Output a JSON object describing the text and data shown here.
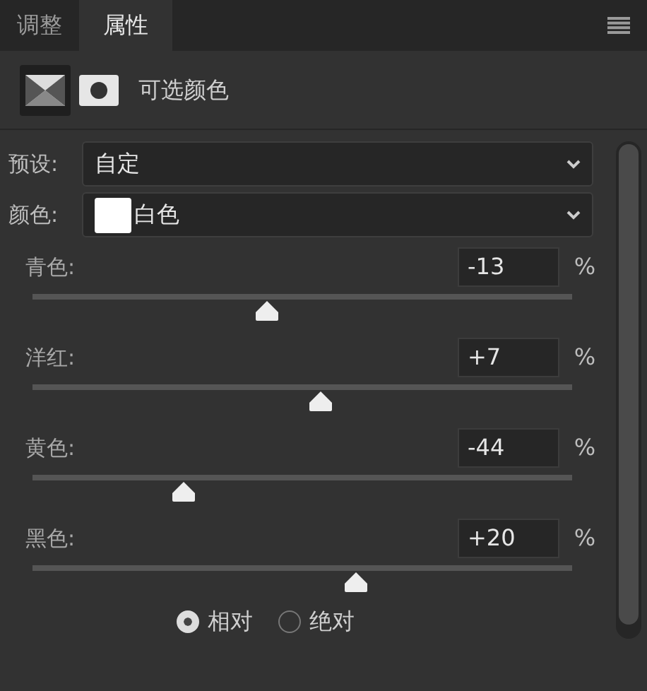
{
  "tabs": [
    {
      "label": "调整",
      "selected": false
    },
    {
      "label": "属性",
      "selected": true
    }
  ],
  "header": {
    "title": "可选颜色"
  },
  "preset": {
    "label": "预设:",
    "value": "自定"
  },
  "color": {
    "label": "颜色:",
    "value": "白色"
  },
  "sliders": [
    {
      "label": "青色:",
      "value": "-13",
      "unit": "%",
      "level": 0.435
    },
    {
      "label": "洋红:",
      "value": "+7",
      "unit": "%",
      "level": 0.535
    },
    {
      "label": "黄色:",
      "value": "-44",
      "unit": "%",
      "level": 0.28
    },
    {
      "label": "黑色:",
      "value": "+20",
      "unit": "%",
      "level": 0.6
    }
  ],
  "method": [
    {
      "label": "相对",
      "selected": true
    },
    {
      "label": "绝对",
      "selected": false
    }
  ]
}
